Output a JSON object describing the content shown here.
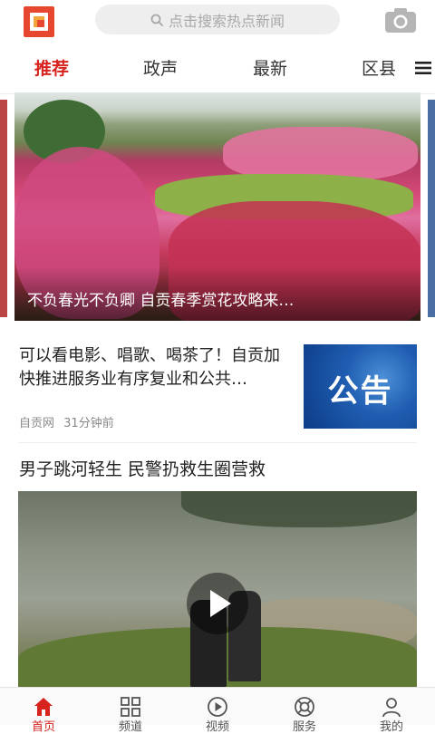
{
  "header": {
    "search_placeholder": "点击搜索热点新闻"
  },
  "tabs": [
    {
      "label": "推荐",
      "active": true
    },
    {
      "label": "政声",
      "active": false
    },
    {
      "label": "最新",
      "active": false
    },
    {
      "label": "区县",
      "active": false
    }
  ],
  "hero": {
    "caption": "不负春光不负卿 自贡春季赏花攻略来…"
  },
  "article1": {
    "title": "可以看电影、唱歌、喝茶了！自贡加快推进服务业有序复业和公共…",
    "source": "自贡网",
    "time": "31分钟前",
    "thumb_text": "公告"
  },
  "article2": {
    "title": "男子跳河轻生 民警扔救生圈营救"
  },
  "bottom_nav": [
    {
      "label": "首页",
      "icon": "home-icon",
      "active": true
    },
    {
      "label": "频道",
      "icon": "grid-icon",
      "active": false
    },
    {
      "label": "视频",
      "icon": "video-icon",
      "active": false
    },
    {
      "label": "服务",
      "icon": "lifebuoy-icon",
      "active": false
    },
    {
      "label": "我的",
      "icon": "user-icon",
      "active": false
    }
  ],
  "colors": {
    "accent": "#d7231e",
    "logo_red": "#e8472f",
    "logo_orange": "#f2a53a"
  }
}
